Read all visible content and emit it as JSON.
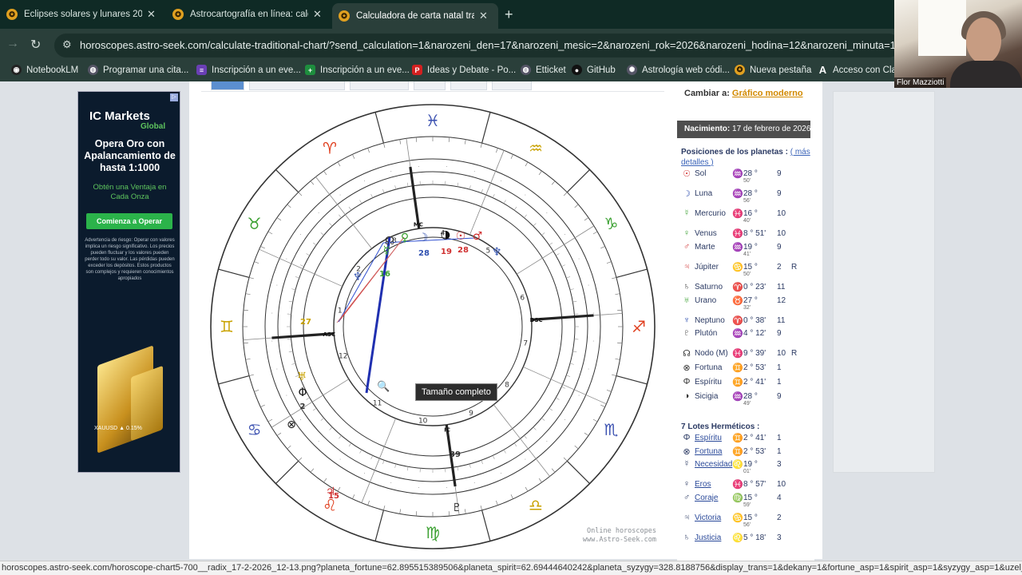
{
  "browser": {
    "tabs": [
      {
        "label": "Eclipses solares y lunares 2026...",
        "active": false
      },
      {
        "label": "Astrocartografía en línea: calcul...",
        "active": false
      },
      {
        "label": "Calculadora de carta natal tradic...",
        "active": true
      }
    ],
    "url": "horoscopes.astro-seek.com/calculate-traditional-chart/?send_calculation=1&narozeni_den=17&narozeni_mesic=2&narozeni_rok=2026&narozeni_hodina=12&narozeni_minuta=13&narozeni",
    "bookmarks": [
      "NotebookLM",
      "Programar una cita...",
      "Inscripción a un eve...",
      "Inscripción a un eve...",
      "Ideas y Debate - Po...",
      "Etticket",
      "GitHub",
      "Astrología web códi...",
      "Nueva pestaña",
      "Acceso con Clave"
    ],
    "status_url": "horoscopes.astro-seek.com/horoscope-chart5-700__radix_17-2-2026_12-13.png?planeta_fortune=62.895515389506&planeta_spirit=62.69444640242&planeta_syzygy=328.8188756&display_trans=1&dekany=1&fortune_asp=1&spirit_asp=1&syzygy_asp=1&uzel_asp=1&"
  },
  "webcam": {
    "name": "Flor Mazziotti"
  },
  "ad": {
    "brand": "IC Markets",
    "brand_sub": "Global",
    "headline": "Opera Oro con Apalancamiento de hasta 1:1000",
    "sub": "Obtén una Ventaja en Cada Onza",
    "cta": "Comienza a Operar",
    "fine": "Advertencia de riesgo: Operar con valores implica un riesgo significativo. Los precios pueden fluctuar y los valores pueden perder todo su valor. Las pérdidas pueden exceder los depósitos. Estos productos son complejos y requieren conocimientos apropiados",
    "ticker": "XAUUSD  ▲ 0.15%"
  },
  "chart": {
    "tooltip": "Tamaño completo",
    "credit_line1": "Online horoscopes",
    "credit_line2": "www.Astro-Seek.com",
    "signs": [
      {
        "glyph": "♓",
        "deg": 0,
        "color": "#3a50b0"
      },
      {
        "glyph": "♒",
        "deg": 30,
        "color": "#c9a200"
      },
      {
        "glyph": "♑",
        "deg": 60,
        "color": "#3aa030"
      },
      {
        "glyph": "♐",
        "deg": 90,
        "color": "#e04020"
      },
      {
        "glyph": "♏",
        "deg": 120,
        "color": "#3a50b0"
      },
      {
        "glyph": "♎",
        "deg": 150,
        "color": "#c9a200"
      },
      {
        "glyph": "♍",
        "deg": 180,
        "color": "#3aa030"
      },
      {
        "glyph": "♌",
        "deg": 210,
        "color": "#e04020"
      },
      {
        "glyph": "♋",
        "deg": 240,
        "color": "#3a50b0"
      },
      {
        "glyph": "♊",
        "deg": 270,
        "color": "#c9a200"
      },
      {
        "glyph": "♉",
        "deg": 300,
        "color": "#3aa030"
      },
      {
        "glyph": "♈",
        "deg": 330,
        "color": "#e04020"
      }
    ],
    "houses": [
      "1",
      "2",
      "3",
      "4",
      "5",
      "6",
      "7",
      "8",
      "9",
      "10",
      "11",
      "12"
    ],
    "angles": {
      "asc": "ASC",
      "dsc": "DSC",
      "mc": "MC",
      "ic": "IC"
    },
    "planet_labels": [
      {
        "text": "28",
        "color": "#d03030"
      },
      {
        "text": "19",
        "color": "#d03030"
      },
      {
        "text": "28",
        "color": "#3050b0"
      },
      {
        "text": "16",
        "color": "#3aa030"
      },
      {
        "text": "15",
        "color": "#d03030"
      },
      {
        "text": "39",
        "color": "#333"
      },
      {
        "text": "2",
        "color": "#333"
      },
      {
        "text": "27",
        "color": "#c9a200"
      }
    ]
  },
  "panel": {
    "switch_label": "Cambiar a:",
    "switch_link": "Gráfico moderno",
    "birth_label": "Nacimiento:",
    "birth_value": "17 de febrero de 2026, 12:13",
    "positions_title": "Posiciones de los planetas :",
    "more": "( más detalles )",
    "planets": [
      {
        "glyph": "☉",
        "gcolor": "#d03030",
        "name": "Sol",
        "sign": "♒",
        "scolor": "#c9a200",
        "deg": "28 °",
        "min": "50'",
        "house": "9",
        "r": ""
      },
      {
        "glyph": "☽",
        "gcolor": "#3050b0",
        "name": "Luna",
        "sign": "♒",
        "scolor": "#c9a200",
        "deg": "28 °",
        "min": "56'",
        "house": "9",
        "r": ""
      },
      {
        "glyph": "☿",
        "gcolor": "#3aa030",
        "name": "Mercurio",
        "sign": "♓",
        "scolor": "#3050b0",
        "deg": "16 °",
        "min": "40'",
        "house": "10",
        "r": ""
      },
      {
        "glyph": "♀",
        "gcolor": "#3aa030",
        "name": "Venus",
        "sign": "♓",
        "scolor": "#3050b0",
        "deg": "8 ° 51'",
        "min": "",
        "house": "10",
        "r": ""
      },
      {
        "glyph": "♂",
        "gcolor": "#d03030",
        "name": "Marte",
        "sign": "♒",
        "scolor": "#c9a200",
        "deg": "19 °",
        "min": "41'",
        "house": "9",
        "r": ""
      },
      {
        "glyph": "♃",
        "gcolor": "#d03030",
        "name": "Júpiter",
        "sign": "♋",
        "scolor": "#3050b0",
        "deg": "15 °",
        "min": "50'",
        "house": "2",
        "r": "R"
      },
      {
        "glyph": "♄",
        "gcolor": "#333",
        "name": "Saturno",
        "sign": "♈",
        "scolor": "#d03030",
        "deg": "0 ° 23'",
        "min": "",
        "house": "11",
        "r": ""
      },
      {
        "glyph": "♅",
        "gcolor": "#3aa030",
        "name": "Urano",
        "sign": "♉",
        "scolor": "#3aa030",
        "deg": "27 °",
        "min": "32'",
        "house": "12",
        "r": ""
      },
      {
        "glyph": "♆",
        "gcolor": "#3050b0",
        "name": "Neptuno",
        "sign": "♈",
        "scolor": "#d03030",
        "deg": "0 ° 38'",
        "min": "",
        "house": "11",
        "r": ""
      },
      {
        "glyph": "♇",
        "gcolor": "#333",
        "name": "Plutón",
        "sign": "♒",
        "scolor": "#c9a200",
        "deg": "4 ° 12'",
        "min": "",
        "house": "9",
        "r": ""
      },
      {
        "glyph": "☊",
        "gcolor": "#333",
        "name": "Nodo (M)",
        "sign": "♓",
        "scolor": "#3050b0",
        "deg": "9 ° 39'",
        "min": "",
        "house": "10",
        "r": "R"
      },
      {
        "glyph": "⊗",
        "gcolor": "#333",
        "name": "Fortuna",
        "sign": "♊",
        "scolor": "#c9a200",
        "deg": "2 ° 53'",
        "min": "",
        "house": "1",
        "r": ""
      },
      {
        "glyph": "Φ",
        "gcolor": "#333",
        "name": "Espíritu",
        "sign": "♊",
        "scolor": "#c9a200",
        "deg": "2 ° 41'",
        "min": "",
        "house": "1",
        "r": ""
      },
      {
        "glyph": "◑",
        "gcolor": "#333",
        "name": "Sicigia",
        "sign": "♒",
        "scolor": "#c9a200",
        "deg": "28 °",
        "min": "49'",
        "house": "9",
        "r": ""
      }
    ],
    "lots_title": "7 Lotes Herméticos :",
    "lots": [
      {
        "glyph": "Φ",
        "name": "Espíritu",
        "sign": "♊",
        "scolor": "#c9a200",
        "deg": "2 ° 41'",
        "min": "",
        "house": "1"
      },
      {
        "glyph": "⊗",
        "name": "Fortuna",
        "sign": "♊",
        "scolor": "#c9a200",
        "deg": "2 ° 53'",
        "min": "",
        "house": "1"
      },
      {
        "glyph": "☿",
        "name": "Necesidad",
        "sign": "♌",
        "scolor": "#d03030",
        "deg": "19 °",
        "min": "01'",
        "house": "3"
      },
      {
        "glyph": "♀",
        "name": "Eros",
        "sign": "♓",
        "scolor": "#3050b0",
        "deg": "8 ° 57'",
        "min": "",
        "house": "10"
      },
      {
        "glyph": "♂",
        "name": "Coraje",
        "sign": "♍",
        "scolor": "#3aa030",
        "deg": "15 °",
        "min": "59'",
        "house": "4"
      },
      {
        "glyph": "♃",
        "name": "Victoria",
        "sign": "♋",
        "scolor": "#3050b0",
        "deg": "15 °",
        "min": "56'",
        "house": "2"
      },
      {
        "glyph": "♄",
        "name": "Justicia",
        "sign": "♌",
        "scolor": "#d03030",
        "deg": "5 ° 18'",
        "min": "",
        "house": "3"
      }
    ]
  }
}
